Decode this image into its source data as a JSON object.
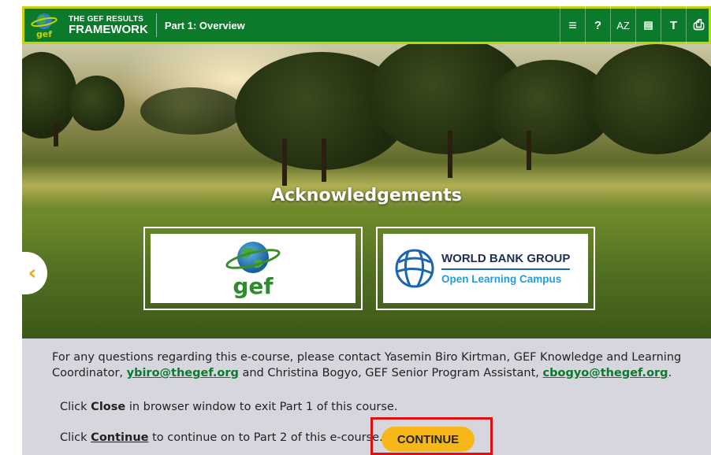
{
  "header": {
    "logo_text": "gef",
    "course_title_line1": "THE GEF RESULTS",
    "course_title_line2": "FRAMEWORK",
    "part_title": "Part 1: Overview",
    "tools": [
      {
        "icon": "menu-icon",
        "glyph": "≡"
      },
      {
        "icon": "help-icon",
        "glyph": "?"
      },
      {
        "icon": "glossary-icon",
        "glyph": "AZ"
      },
      {
        "icon": "document-icon",
        "glyph": "▤"
      },
      {
        "icon": "text-size-icon",
        "glyph": "T"
      },
      {
        "icon": "print-icon",
        "glyph": "⎙"
      }
    ]
  },
  "hero": {
    "title": "Acknowledgements",
    "gef_logo_text": "gef",
    "wb_line1": "WORLD BANK GROUP",
    "wb_line2": "Open Learning Campus"
  },
  "body": {
    "intro_part1": "For any questions regarding this e-course, please contact Yasemin Biro Kirtman, GEF Knowledge and Learning Coordinator, ",
    "email1": "ybiro@thegef.org",
    "intro_part2": " and Christina Bogyo, GEF Senior Program Assistant, ",
    "email2": "cbogyo@thegef.org",
    "intro_part3": ".",
    "close_prefix": "Click ",
    "close_word": "Close",
    "close_suffix": " in browser window to exit Part 1 of this course.",
    "continue_prefix": "Click ",
    "continue_word": "Continue",
    "continue_suffix": " to continue on to Part 2 of this e-course.",
    "continue_button": "CONTINUE"
  },
  "colors": {
    "header_green": "#0b7a2a",
    "header_border": "#c8d400",
    "continue_yellow": "#f7b718",
    "highlight_red": "#e01010",
    "link_green": "#0b7a2a"
  }
}
